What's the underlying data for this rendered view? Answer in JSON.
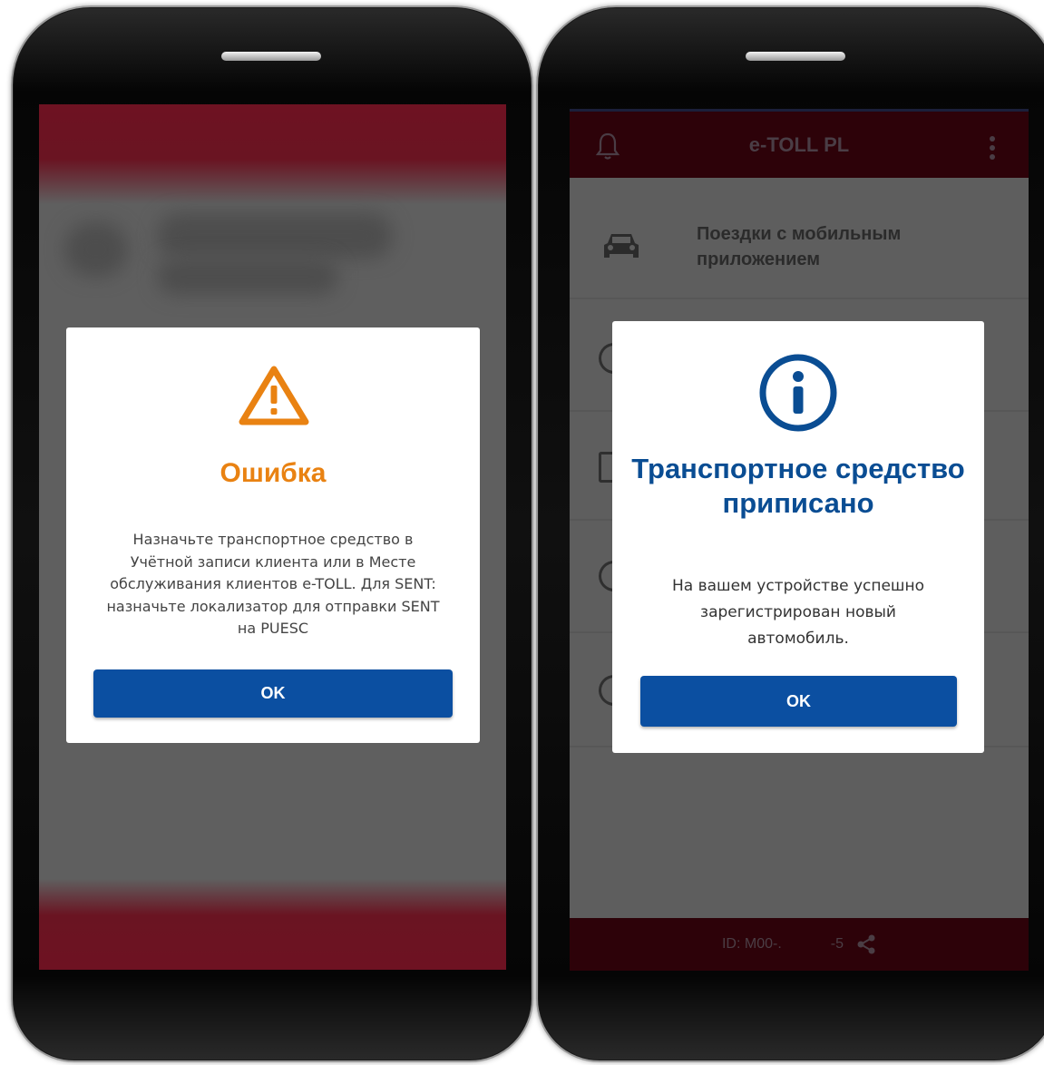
{
  "left_phone": {
    "dialog": {
      "icon": "warning-triangle-icon",
      "title": "Ошибка",
      "message": "Назначьте транспортное средство в Учётной записи клиента или в Месте обслуживания клиентов e-TOLL. Для SENT: назначьте локализатор для отправки SENT на PUESC",
      "ok_label": "OK"
    }
  },
  "right_phone": {
    "app_bar": {
      "title": "e-TOLL PL",
      "left_icon": "bell-icon",
      "right_icon": "more-vertical-icon"
    },
    "menu_items": [
      {
        "label": "Поездки с мобильным приложением",
        "icon": "car-icon"
      }
    ],
    "dialog": {
      "icon": "info-circle-icon",
      "title": "Транспортное средство приписано",
      "message": "На вашем устройстве успешно зарегистрирован новый автомобиль.",
      "ok_label": "OK"
    },
    "bottom_bar": {
      "id_text": "ID:  M00-.",
      "suffix_text": "-5",
      "share_icon": "share-icon"
    }
  },
  "colors": {
    "brand_bar": "#2d0209",
    "error_title": "#e98212",
    "info_title": "#0a4d93",
    "button": "#0b4fa1"
  }
}
